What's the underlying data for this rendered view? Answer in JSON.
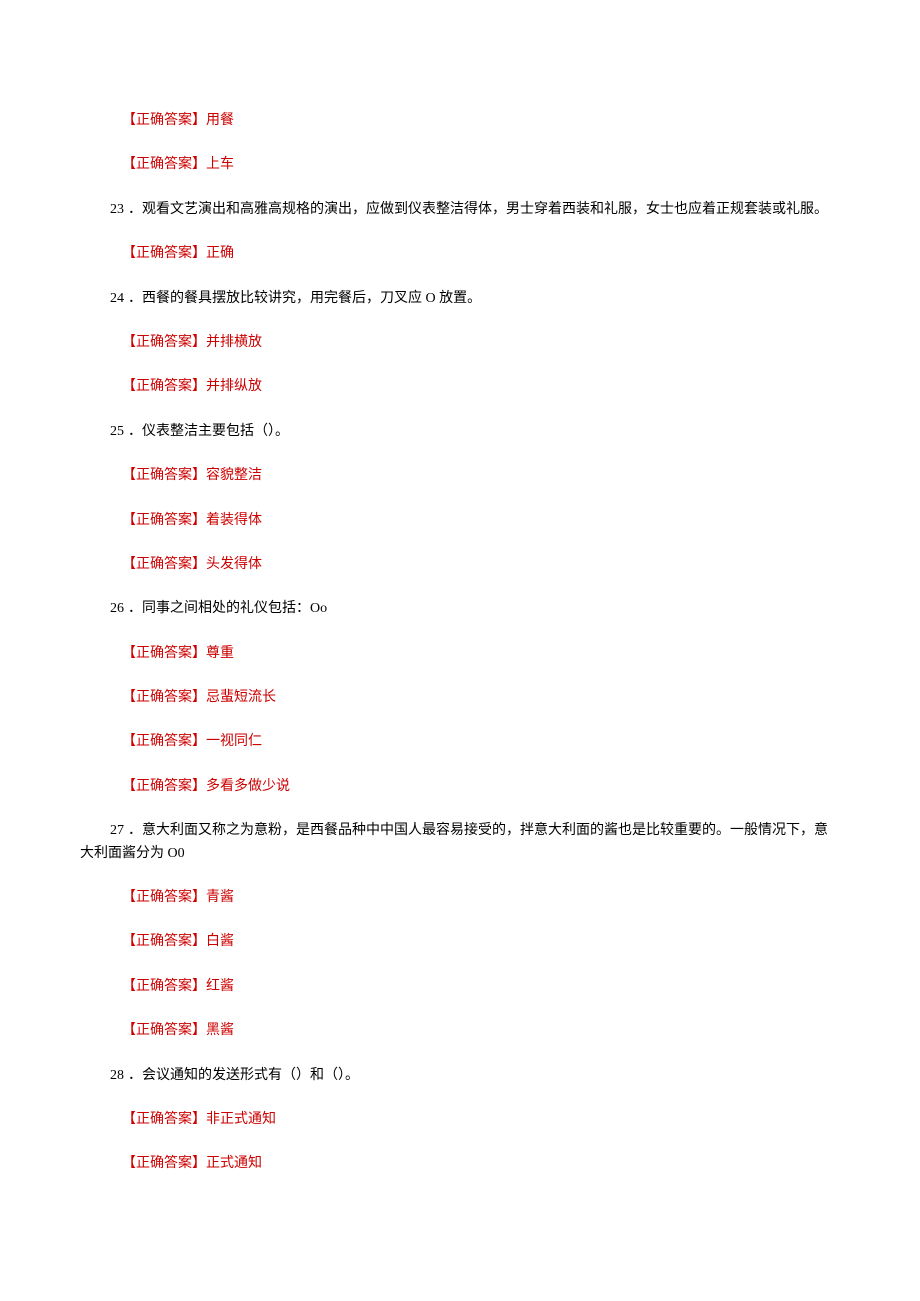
{
  "answer_label": "【正确答案】",
  "items": [
    {
      "type": "answer",
      "text": "用餐"
    },
    {
      "type": "answer",
      "text": "上车"
    },
    {
      "type": "question_wrapped",
      "num": "23",
      "text": "．观看文艺演出和高雅高规格的演出，应做到仪表整洁得体，男士穿着西装和礼服，女士也应着正规套装或礼服。"
    },
    {
      "type": "answer",
      "text": "正确"
    },
    {
      "type": "question",
      "num": "24",
      "text": "．西餐的餐具摆放比较讲究，用完餐后，刀叉应 O 放置。"
    },
    {
      "type": "answer",
      "text": "并排横放"
    },
    {
      "type": "answer",
      "text": "并排纵放"
    },
    {
      "type": "question",
      "num": "25",
      "text": "．仪表整洁主要包括（）。"
    },
    {
      "type": "answer",
      "text": "容貌整洁"
    },
    {
      "type": "answer",
      "text": "着装得体"
    },
    {
      "type": "answer",
      "text": "头发得体"
    },
    {
      "type": "question",
      "num": "26",
      "text": "．同事之间相处的礼仪包括：Oo"
    },
    {
      "type": "answer",
      "text": "尊重"
    },
    {
      "type": "answer",
      "text": "忌蜚短流长"
    },
    {
      "type": "answer",
      "text": "一视同仁"
    },
    {
      "type": "answer",
      "text": "多看多做少说"
    },
    {
      "type": "question_wrapped",
      "num": "27",
      "text": "．意大利面又称之为意粉，是西餐品种中中国人最容易接受的，拌意大利面的酱也是比较重要的。一般情况下，意大利面酱分为 O0"
    },
    {
      "type": "answer",
      "text": "青酱"
    },
    {
      "type": "answer",
      "text": "白酱"
    },
    {
      "type": "answer",
      "text": "红酱"
    },
    {
      "type": "answer",
      "text": "黑酱"
    },
    {
      "type": "question",
      "num": "28",
      "text": "．会议通知的发送形式有（）和（）。"
    },
    {
      "type": "answer",
      "text": "非正式通知"
    },
    {
      "type": "answer",
      "text": "正式通知"
    }
  ]
}
